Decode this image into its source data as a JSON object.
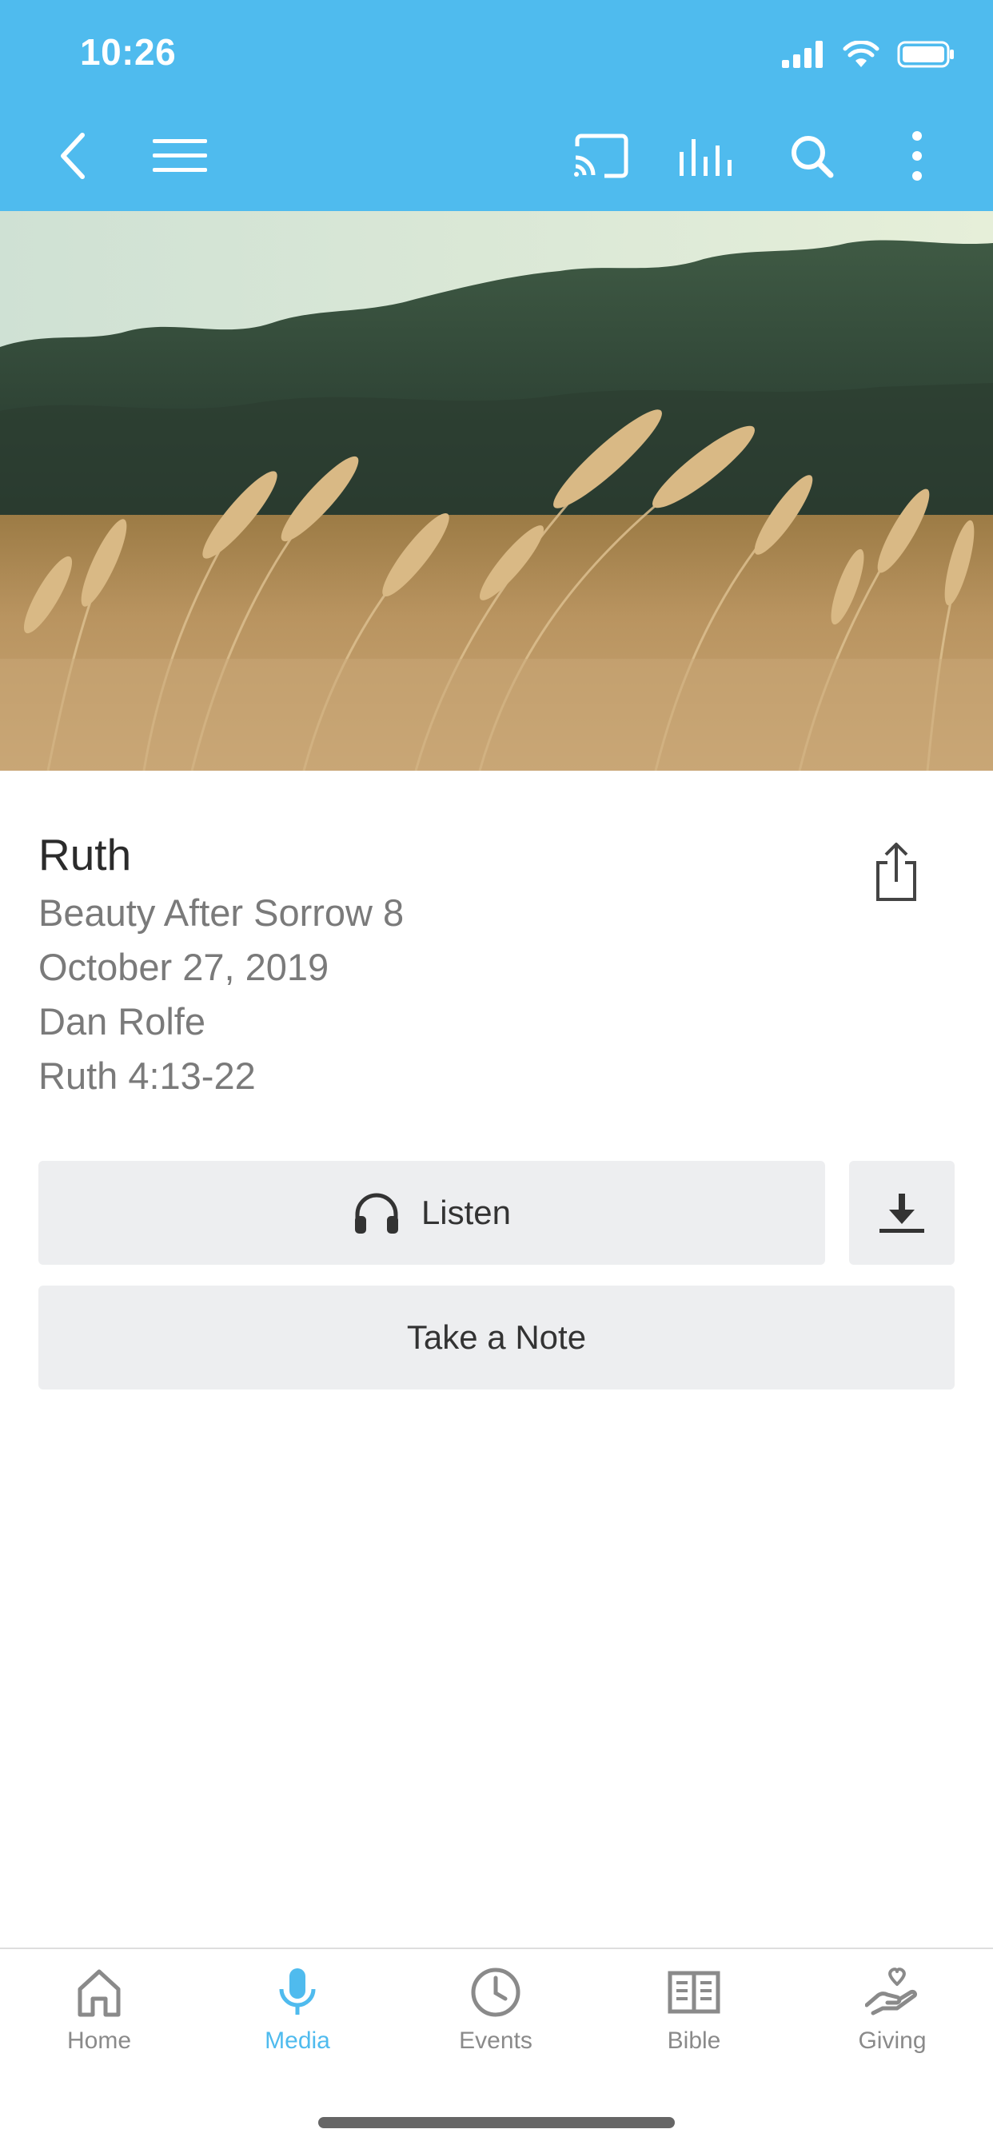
{
  "status_bar": {
    "time": "10:26"
  },
  "toolbar": {
    "icons": [
      "back-chevron-icon",
      "menu-icon",
      "cast-icon",
      "equalizer-icon",
      "search-icon",
      "more-vertical-icon"
    ]
  },
  "media": {
    "title": "Ruth",
    "series": "Beauty After Sorrow 8",
    "date": "October 27, 2019",
    "speaker": "Dan Rolfe",
    "scripture": "Ruth 4:13-22"
  },
  "actions": {
    "listen_label": "Listen",
    "note_label": "Take a Note"
  },
  "tabs": [
    {
      "label": "Home",
      "icon": "home-icon",
      "active": false
    },
    {
      "label": "Media",
      "icon": "microphone-icon",
      "active": true
    },
    {
      "label": "Events",
      "icon": "clock-icon",
      "active": false
    },
    {
      "label": "Bible",
      "icon": "book-icon",
      "active": false
    },
    {
      "label": "Giving",
      "icon": "giving-hand-heart-icon",
      "active": false
    }
  ],
  "colors": {
    "accent": "#4fbbee",
    "button_bg": "#edeef0",
    "muted_text": "#7a7a7a"
  }
}
